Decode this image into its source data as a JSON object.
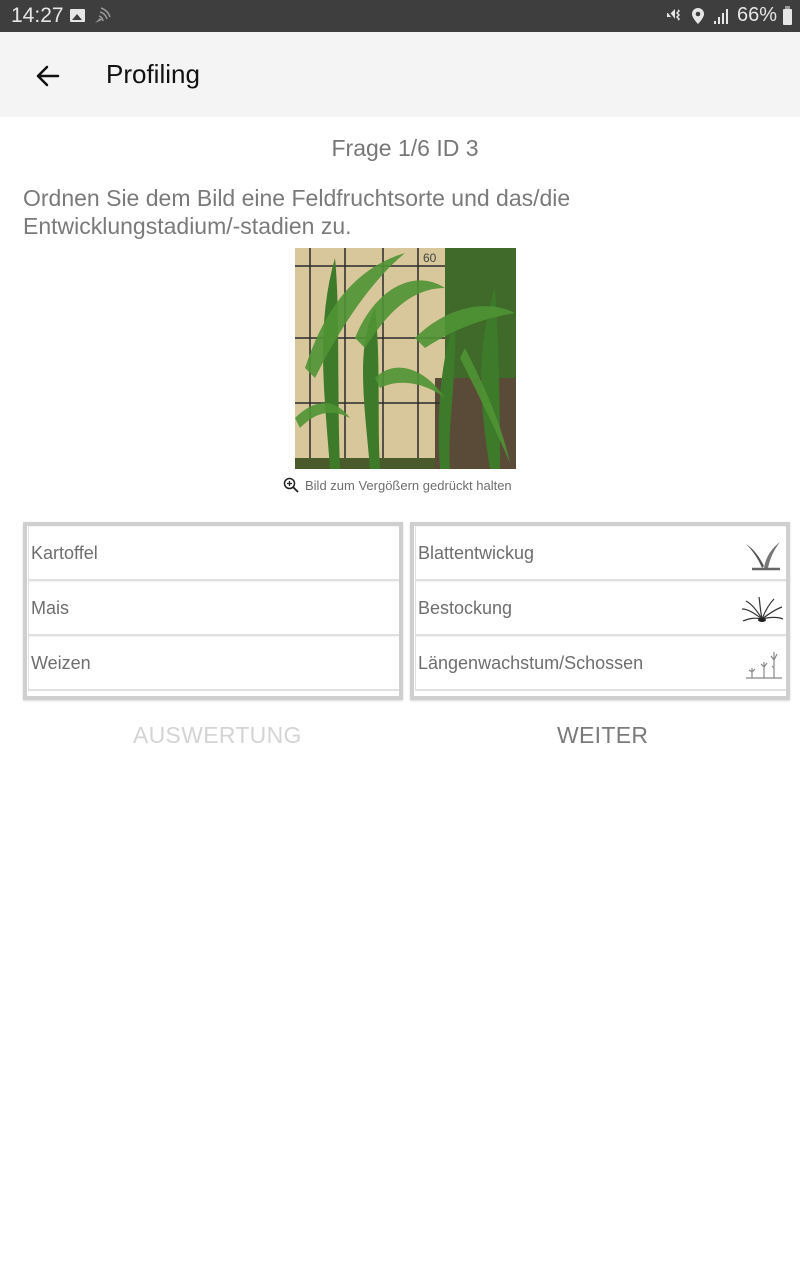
{
  "status_bar": {
    "time": "14:27",
    "battery": "66%",
    "icons_left": [
      "image-icon",
      "cast-icon"
    ],
    "icons_right": [
      "mute-icon",
      "location-icon",
      "signal-icon",
      "battery-charging-icon"
    ]
  },
  "app_bar": {
    "title": "Profiling",
    "back_icon": "arrow-left-icon"
  },
  "question": {
    "counter": "Frage 1/6 ID 3",
    "text": "Ordnen Sie dem Bild eine Feldfruchtsorte und das/die Entwicklungstadium/-stadien zu.",
    "image_description": "Young maize plants in front of a measuring board marked 60",
    "zoom_hint": "Bild zum Vergößern gedrückt halten",
    "zoom_icon": "zoom-in-icon"
  },
  "crops": {
    "items": [
      {
        "label": "Kartoffel"
      },
      {
        "label": "Mais"
      },
      {
        "label": "Weizen"
      }
    ]
  },
  "stages": {
    "items": [
      {
        "label": "Blattentwickug",
        "icon": "leaf-development-icon"
      },
      {
        "label": "Bestockung",
        "icon": "tillering-icon"
      },
      {
        "label": "Längenwachstum/Schossen",
        "icon": "stem-elongation-icon"
      }
    ]
  },
  "actions": {
    "evaluate_label": "AUSWERTUNG",
    "next_label": "WEITER"
  }
}
